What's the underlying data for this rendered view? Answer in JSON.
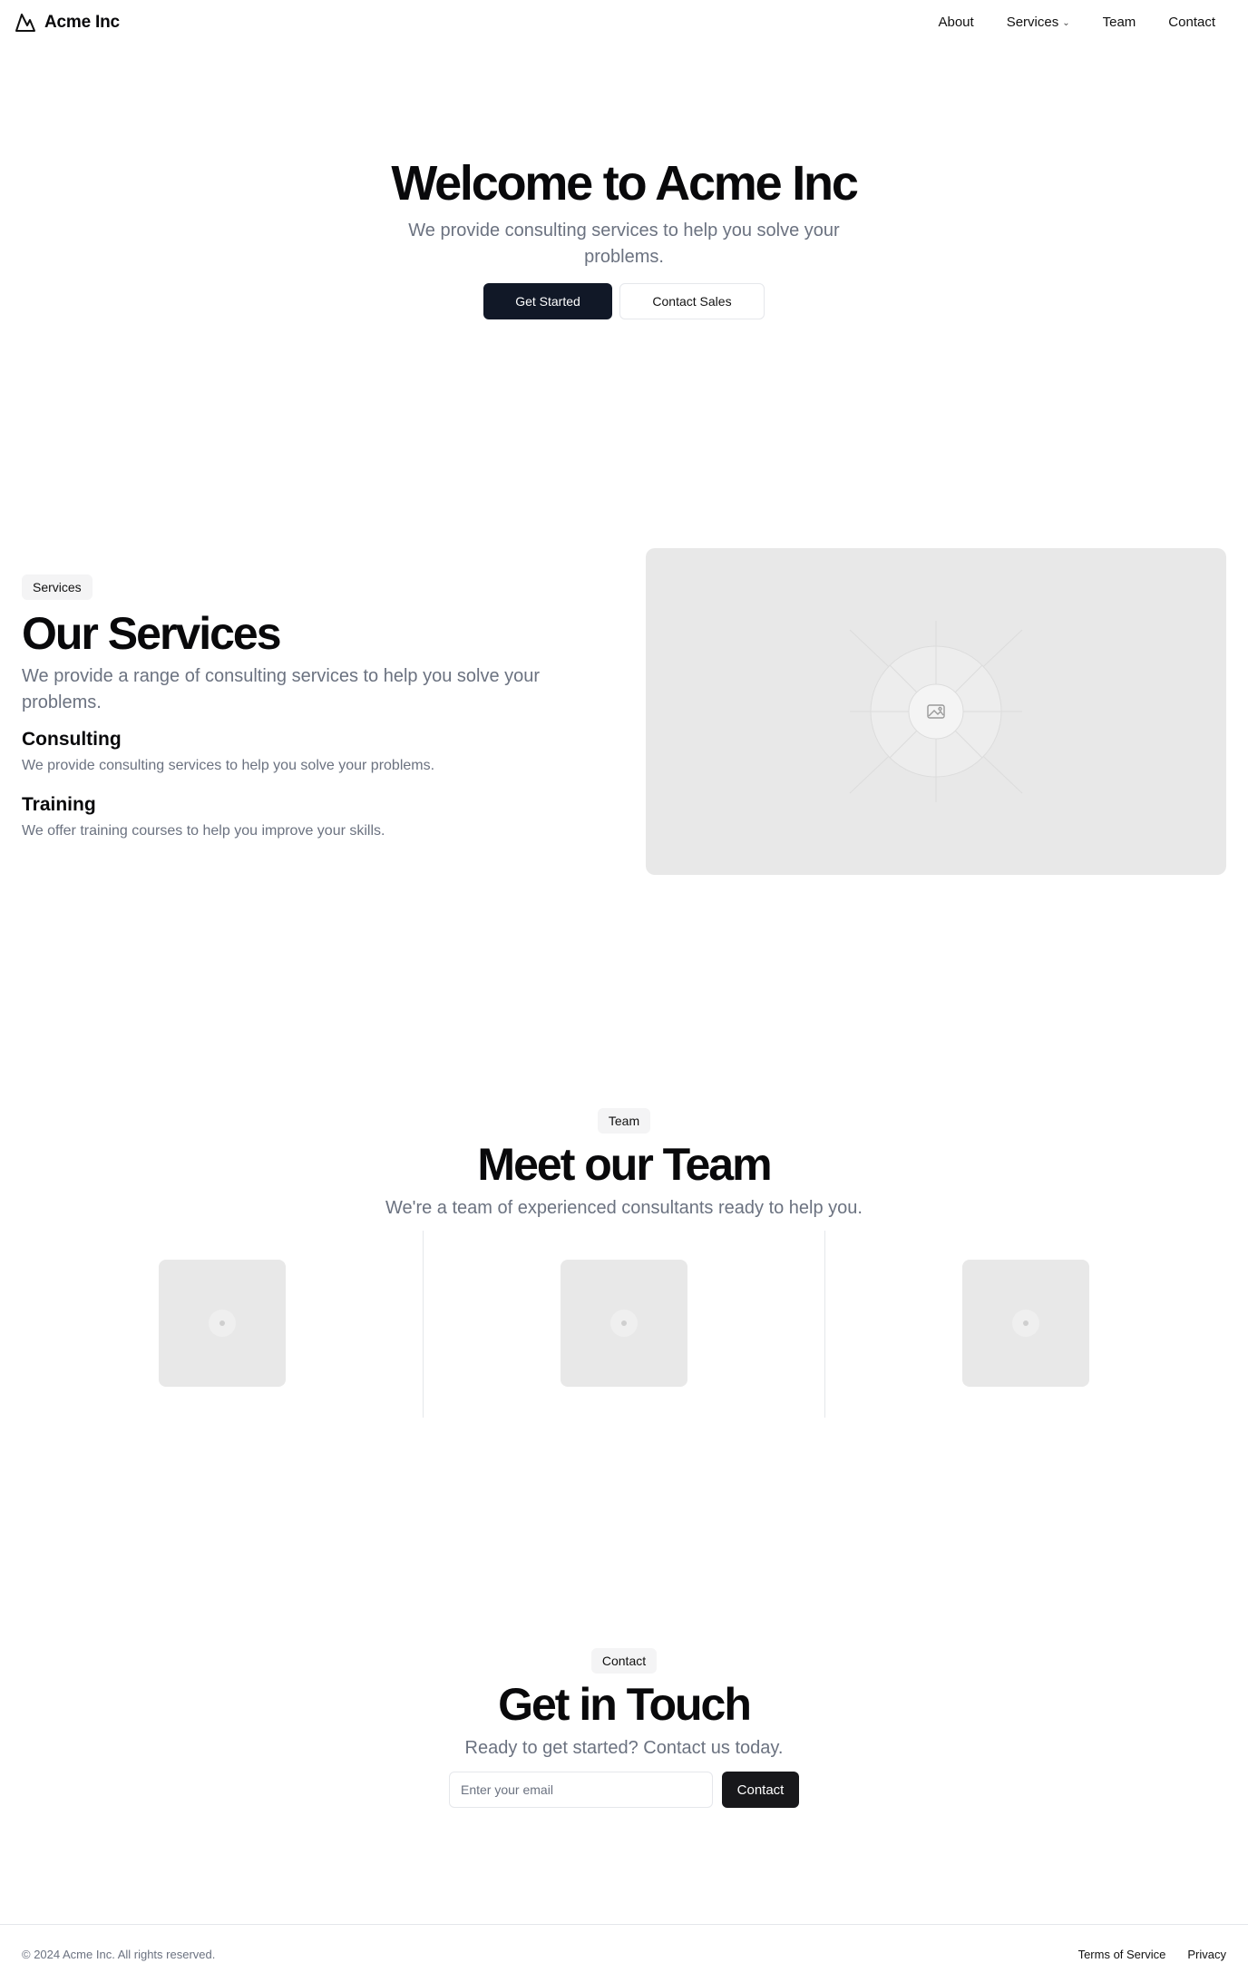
{
  "header": {
    "brand": "Acme Inc",
    "nav": [
      {
        "label": "About"
      },
      {
        "label": "Services"
      },
      {
        "label": "Team"
      },
      {
        "label": "Contact"
      }
    ]
  },
  "hero": {
    "title": "Welcome to Acme Inc",
    "subtitle": "We provide consulting services to help you solve your problems.",
    "primary_button": "Get Started",
    "secondary_button": "Contact Sales"
  },
  "services": {
    "badge": "Services",
    "title": "Our Services",
    "lead": "We provide a range of consulting services to help you solve your problems.",
    "items": [
      {
        "title": "Consulting",
        "description": "We provide consulting services to help you solve your problems."
      },
      {
        "title": "Training",
        "description": "We offer training courses to help you improve your skills."
      }
    ]
  },
  "team": {
    "badge": "Team",
    "title": "Meet our Team",
    "lead": "We're a team of experienced consultants ready to help you."
  },
  "contact": {
    "badge": "Contact",
    "title": "Get in Touch",
    "lead": "Ready to get started? Contact us today.",
    "email_placeholder": "Enter your email",
    "button": "Contact"
  },
  "footer": {
    "copyright": "© 2024 Acme Inc. All rights reserved.",
    "links": [
      {
        "label": "Terms of Service"
      },
      {
        "label": "Privacy"
      }
    ]
  },
  "colors": {
    "primary_button": "#111827",
    "contact_button": "#18181b",
    "muted_text": "#6b7280",
    "placeholder_bg": "#e8e8e8"
  },
  "icons": {
    "brand": "mountain-icon",
    "services_dropdown": "chevron-down-icon",
    "services_image": "image-placeholder-icon"
  }
}
